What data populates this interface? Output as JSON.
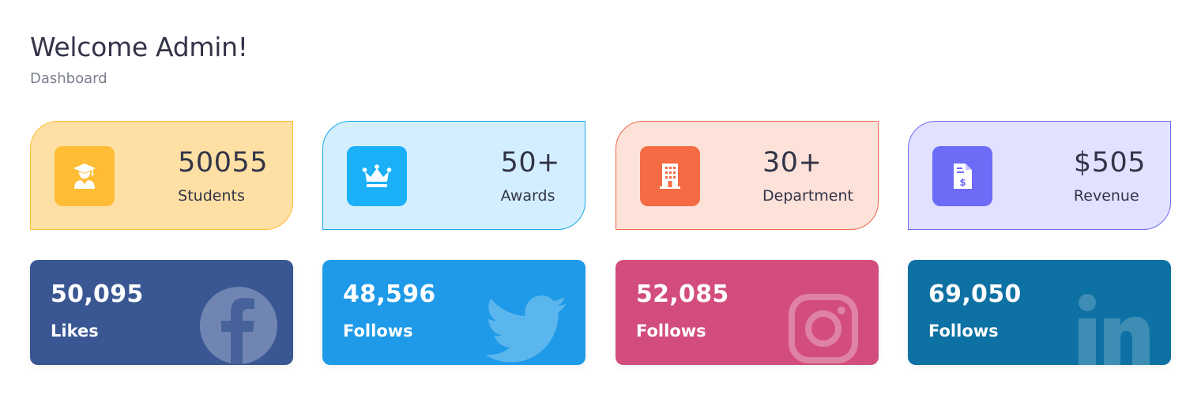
{
  "header": {
    "title": "Welcome Admin!",
    "breadcrumb": "Dashboard"
  },
  "stats": [
    {
      "value": "50055",
      "label": "Students",
      "icon": "graduate-icon",
      "icon_color": "#ffbc35",
      "bg": "#fee0a4",
      "border": "#ffbc35"
    },
    {
      "value": "50+",
      "label": "Awards",
      "icon": "crown-icon",
      "icon_color": "#1bb0f7",
      "bg": "#d3efff",
      "border": "#1ba6e8"
    },
    {
      "value": "30+",
      "label": "Department",
      "icon": "building-icon",
      "icon_color": "#f56b44",
      "bg": "#fde2d9",
      "border": "#ee6a47"
    },
    {
      "value": "$505",
      "label": "Revenue",
      "icon": "invoice-icon",
      "icon_color": "#6e6bf7",
      "bg": "#e2e1ff",
      "border": "#6e6bf7"
    }
  ],
  "social": [
    {
      "value": "50,095",
      "label": "Likes",
      "network": "facebook",
      "icon": "facebook-icon",
      "bg": "#3a5794"
    },
    {
      "value": "48,596",
      "label": "Follows",
      "network": "twitter",
      "icon": "twitter-icon",
      "bg": "#1e9ae8"
    },
    {
      "value": "52,085",
      "label": "Follows",
      "network": "instagram",
      "icon": "instagram-icon",
      "bg": "#d24d7d"
    },
    {
      "value": "69,050",
      "label": "Follows",
      "network": "linkedin",
      "icon": "linkedin-icon",
      "bg": "#0e71a3"
    }
  ]
}
